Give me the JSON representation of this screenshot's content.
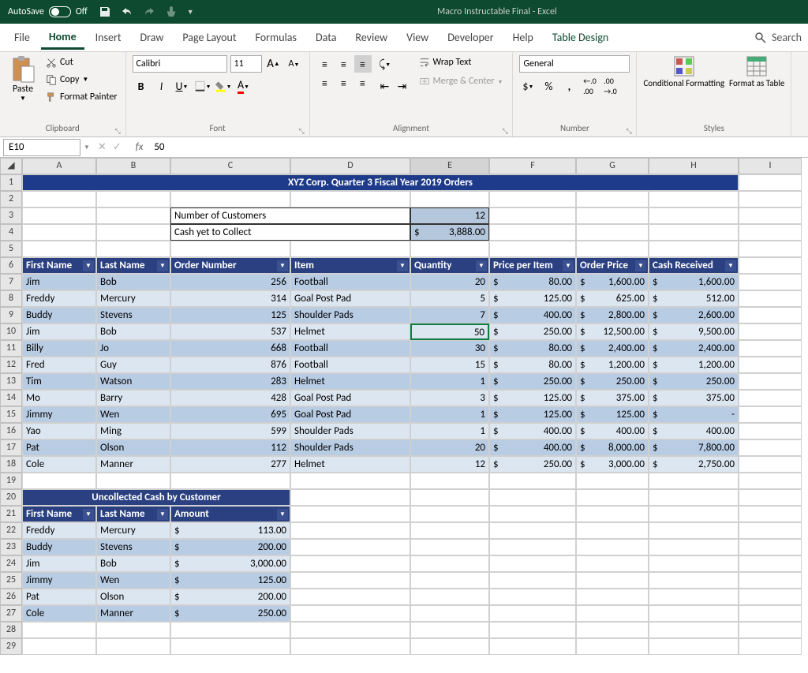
{
  "titlebar": {
    "autosave_label": "AutoSave",
    "autosave_state": "Off",
    "title": "Macro Instructable Final  -  Excel"
  },
  "tabs": {
    "file": "File",
    "home": "Home",
    "insert": "Insert",
    "draw": "Draw",
    "page_layout": "Page Layout",
    "formulas": "Formulas",
    "data": "Data",
    "review": "Review",
    "view": "View",
    "developer": "Developer",
    "help": "Help",
    "table_design": "Table Design",
    "search": "Search"
  },
  "ribbon": {
    "clipboard": {
      "paste": "Paste",
      "cut": "Cut",
      "copy": "Copy",
      "format_painter": "Format Painter",
      "label": "Clipboard"
    },
    "font": {
      "name": "Calibri",
      "size": "11",
      "label": "Font"
    },
    "alignment": {
      "wrap": "Wrap Text",
      "merge": "Merge & Center",
      "label": "Alignment"
    },
    "number": {
      "format": "General",
      "label": "Number"
    },
    "styles": {
      "conditional": "Conditional Formatting",
      "format_table": "Format as Table",
      "label": "Styles"
    }
  },
  "formula_bar": {
    "cell_ref": "E10",
    "value": "50"
  },
  "cols": [
    "A",
    "B",
    "C",
    "D",
    "E",
    "F",
    "G",
    "H",
    "I"
  ],
  "sheet": {
    "title": "XYZ Corp. Quarter 3 Fiscal Year 2019 Orders",
    "summary": {
      "num_customers_label": "Number of Customers",
      "num_customers": "12",
      "cash_label": "Cash yet to Collect",
      "cash": "3,888.00"
    },
    "headers": [
      "First Name",
      "Last Name",
      "Order Number",
      "Item",
      "Quantity",
      "Price per Item",
      "Order Price",
      "Cash Received"
    ],
    "rows": [
      {
        "fn": "Jim",
        "ln": "Bob",
        "on": "256",
        "item": "Football",
        "qty": "20",
        "ppi": "80.00",
        "op": "1,600.00",
        "cr": "1,600.00"
      },
      {
        "fn": "Freddy",
        "ln": "Mercury",
        "on": "314",
        "item": "Goal Post Pad",
        "qty": "5",
        "ppi": "125.00",
        "op": "625.00",
        "cr": "512.00"
      },
      {
        "fn": "Buddy",
        "ln": "Stevens",
        "on": "125",
        "item": "Shoulder Pads",
        "qty": "7",
        "ppi": "400.00",
        "op": "2,800.00",
        "cr": "2,600.00"
      },
      {
        "fn": "Jim",
        "ln": "Bob",
        "on": "537",
        "item": "Helmet",
        "qty": "50",
        "ppi": "250.00",
        "op": "12,500.00",
        "cr": "9,500.00"
      },
      {
        "fn": "Billy",
        "ln": "Jo",
        "on": "668",
        "item": "Football",
        "qty": "30",
        "ppi": "80.00",
        "op": "2,400.00",
        "cr": "2,400.00"
      },
      {
        "fn": "Fred",
        "ln": "Guy",
        "on": "876",
        "item": "Football",
        "qty": "15",
        "ppi": "80.00",
        "op": "1,200.00",
        "cr": "1,200.00"
      },
      {
        "fn": "Tim",
        "ln": "Watson",
        "on": "283",
        "item": "Helmet",
        "qty": "1",
        "ppi": "250.00",
        "op": "250.00",
        "cr": "250.00"
      },
      {
        "fn": "Mo",
        "ln": "Barry",
        "on": "428",
        "item": "Goal Post Pad",
        "qty": "3",
        "ppi": "125.00",
        "op": "375.00",
        "cr": "375.00"
      },
      {
        "fn": "Jimmy",
        "ln": "Wen",
        "on": "695",
        "item": "Goal Post Pad",
        "qty": "1",
        "ppi": "125.00",
        "op": "125.00",
        "cr": "-"
      },
      {
        "fn": "Yao",
        "ln": "Ming",
        "on": "599",
        "item": "Shoulder Pads",
        "qty": "1",
        "ppi": "400.00",
        "op": "400.00",
        "cr": "400.00"
      },
      {
        "fn": "Pat",
        "ln": "Olson",
        "on": "112",
        "item": "Shoulder Pads",
        "qty": "20",
        "ppi": "400.00",
        "op": "8,000.00",
        "cr": "7,800.00"
      },
      {
        "fn": "Cole",
        "ln": "Manner",
        "on": "277",
        "item": "Helmet",
        "qty": "12",
        "ppi": "250.00",
        "op": "3,000.00",
        "cr": "2,750.00"
      }
    ],
    "uncollected_title": "Uncollected Cash by Customer",
    "uncollected_headers": [
      "First Name",
      "Last Name",
      "Amount"
    ],
    "uncollected": [
      {
        "fn": "Freddy",
        "ln": "Mercury",
        "amt": "113.00"
      },
      {
        "fn": "Buddy",
        "ln": "Stevens",
        "amt": "200.00"
      },
      {
        "fn": "Jim",
        "ln": "Bob",
        "amt": "3,000.00"
      },
      {
        "fn": "Jimmy",
        "ln": "Wen",
        "amt": "125.00"
      },
      {
        "fn": "Pat",
        "ln": "Olson",
        "amt": "200.00"
      },
      {
        "fn": "Cole",
        "ln": "Manner",
        "amt": "250.00"
      }
    ]
  },
  "chart_data": {
    "type": "table",
    "title": "XYZ Corp. Quarter 3 Fiscal Year 2019 Orders",
    "columns": [
      "First Name",
      "Last Name",
      "Order Number",
      "Item",
      "Quantity",
      "Price per Item",
      "Order Price",
      "Cash Received"
    ],
    "rows": [
      [
        "Jim",
        "Bob",
        256,
        "Football",
        20,
        80.0,
        1600.0,
        1600.0
      ],
      [
        "Freddy",
        "Mercury",
        314,
        "Goal Post Pad",
        5,
        125.0,
        625.0,
        512.0
      ],
      [
        "Buddy",
        "Stevens",
        125,
        "Shoulder Pads",
        7,
        400.0,
        2800.0,
        2600.0
      ],
      [
        "Jim",
        "Bob",
        537,
        "Helmet",
        50,
        250.0,
        12500.0,
        9500.0
      ],
      [
        "Billy",
        "Jo",
        668,
        "Football",
        30,
        80.0,
        2400.0,
        2400.0
      ],
      [
        "Fred",
        "Guy",
        876,
        "Football",
        15,
        80.0,
        1200.0,
        1200.0
      ],
      [
        "Tim",
        "Watson",
        283,
        "Helmet",
        1,
        250.0,
        250.0,
        250.0
      ],
      [
        "Mo",
        "Barry",
        428,
        "Goal Post Pad",
        3,
        125.0,
        375.0,
        375.0
      ],
      [
        "Jimmy",
        "Wen",
        695,
        "Goal Post Pad",
        1,
        125.0,
        125.0,
        0.0
      ],
      [
        "Yao",
        "Ming",
        599,
        "Shoulder Pads",
        1,
        400.0,
        400.0,
        400.0
      ],
      [
        "Pat",
        "Olson",
        112,
        "Shoulder Pads",
        20,
        400.0,
        8000.0,
        7800.0
      ],
      [
        "Cole",
        "Manner",
        277,
        "Helmet",
        12,
        250.0,
        3000.0,
        2750.0
      ]
    ],
    "summary": {
      "num_customers": 12,
      "cash_yet_to_collect": 3888.0
    }
  }
}
